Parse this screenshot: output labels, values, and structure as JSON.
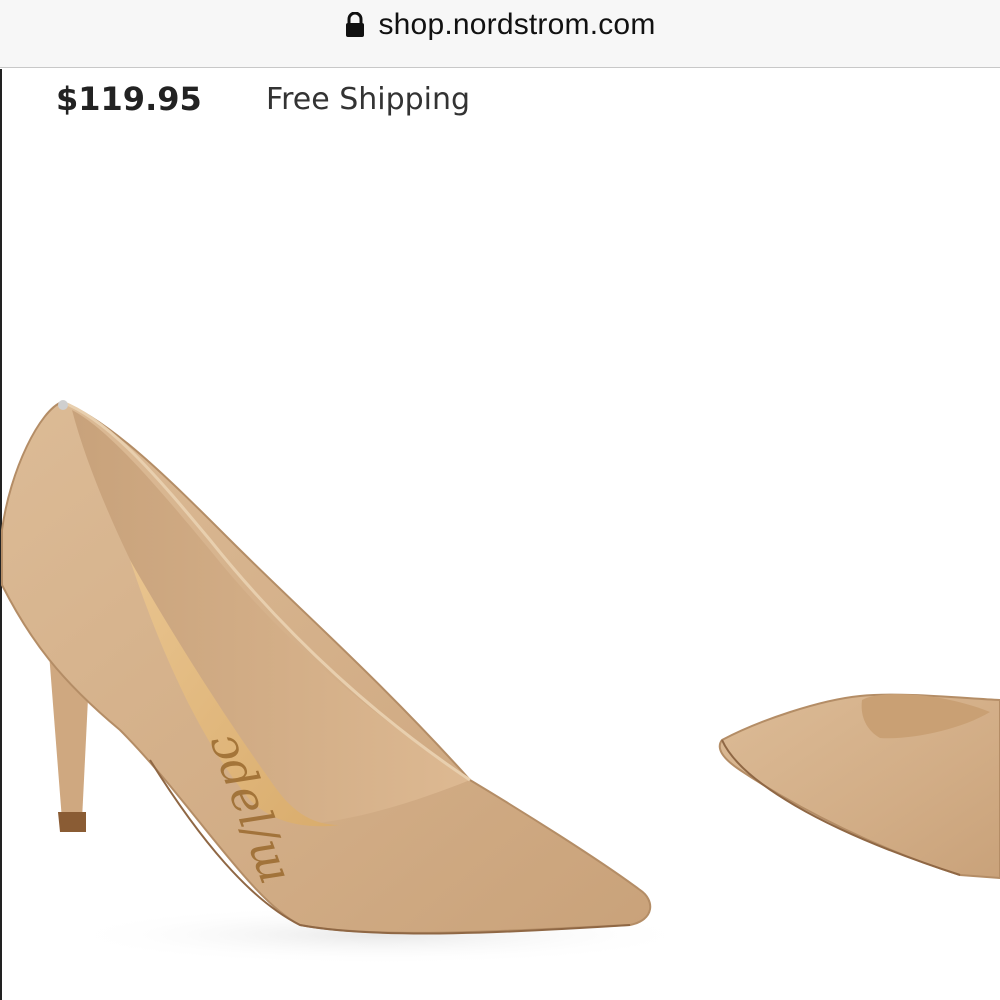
{
  "browser": {
    "url": "shop.nordstrom.com",
    "lock_icon": "lock-icon"
  },
  "product": {
    "price": "$119.95",
    "shipping": "Free Shipping",
    "image": {
      "subject": "nude pointed-toe stiletto pump",
      "colors": {
        "leather": "#d8b48e",
        "shadow": "#b8906a",
        "insole": "#e2b97e",
        "brand_script": "#9a6a2e"
      }
    }
  }
}
